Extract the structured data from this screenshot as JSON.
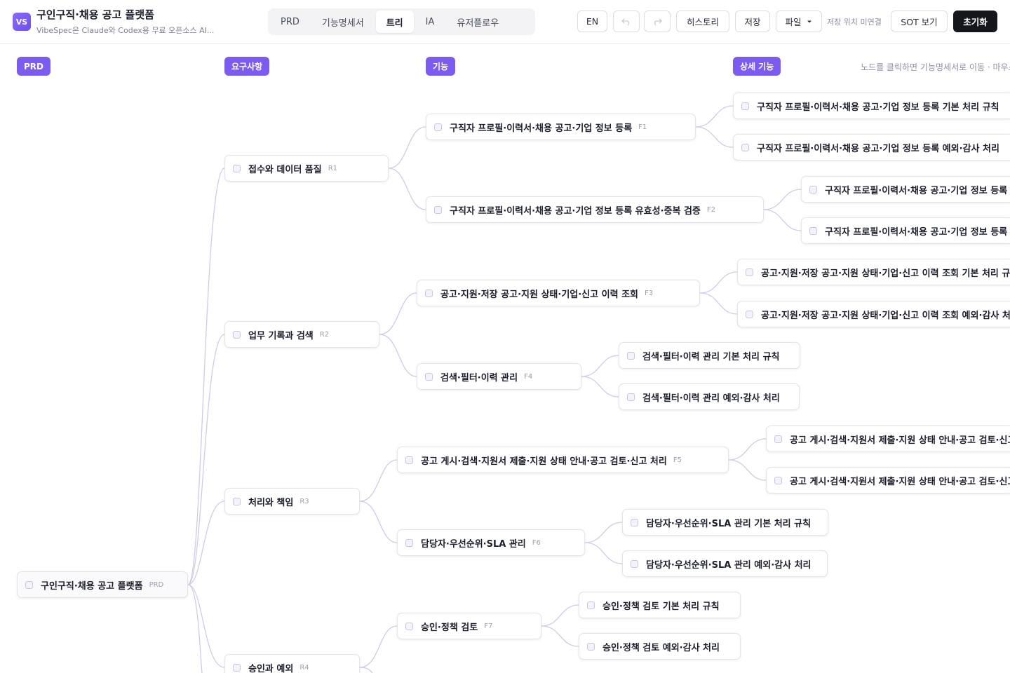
{
  "app": {
    "logo": "VS",
    "title": "구인구직·채용 공고 플랫폼",
    "subtitle": "VibeSpec은 Claude와 Codex용 무료 오픈소스 AI..."
  },
  "tabs": [
    {
      "label": "PRD",
      "active": false
    },
    {
      "label": "기능명세서",
      "active": false
    },
    {
      "label": "트리",
      "active": true
    },
    {
      "label": "IA",
      "active": false
    },
    {
      "label": "유저플로우",
      "active": false
    }
  ],
  "toolbar": {
    "lang": "EN",
    "undo_icon": "undo-icon",
    "redo_icon": "redo-icon",
    "history": "히스토리",
    "save": "저장",
    "file": "파일",
    "save_location": "저장 위치 미연결",
    "sot": "SOT 보기",
    "reset": "초기화"
  },
  "columns": {
    "prd": "PRD",
    "requirements": "요구사항",
    "features": "기능",
    "details": "상세 기능"
  },
  "hint": "노드를 클릭하면 기능명세서로 이동 · 마우스",
  "tree": {
    "root": {
      "label": "구인구직·채용 공고 플랫폼",
      "id": "PRD"
    },
    "requirements": [
      {
        "label": "접수와 데이터 품질",
        "id": "R1"
      },
      {
        "label": "업무 기록과 검색",
        "id": "R2"
      },
      {
        "label": "처리와 책임",
        "id": "R3"
      },
      {
        "label": "승인과 예외",
        "id": "R4"
      }
    ],
    "features": [
      {
        "label": "구직자 프로필·이력서·채용 공고·기업 정보 등록",
        "id": "F1"
      },
      {
        "label": "구직자 프로필·이력서·채용 공고·기업 정보 등록 유효성·중복 검증",
        "id": "F2"
      },
      {
        "label": "공고·지원·저장 공고·지원 상태·기업·신고 이력 조회",
        "id": "F3"
      },
      {
        "label": "검색·필터·이력 관리",
        "id": "F4"
      },
      {
        "label": "공고 게시·검색·지원서 제출·지원 상태 안내·공고 검토·신고 처리",
        "id": "F5"
      },
      {
        "label": "담당자·우선순위·SLA 관리",
        "id": "F6"
      },
      {
        "label": "승인·정책 검토",
        "id": "F7"
      }
    ],
    "details": [
      "구직자 프로필·이력서·채용 공고·기업 정보 등록 기본 처리 규칙",
      "구직자 프로필·이력서·채용 공고·기업 정보 등록 예외·감사 처리",
      "구직자 프로필·이력서·채용 공고·기업 정보 등록 유효성·중복 검증 기본 처리 규칙",
      "구직자 프로필·이력서·채용 공고·기업 정보 등록 유효성·중복 검증 예외·감사 처리",
      "공고·지원·저장 공고·지원 상태·기업·신고 이력 조회 기본 처리 규칙",
      "공고·지원·저장 공고·지원 상태·기업·신고 이력 조회 예외·감사 처리",
      "검색·필터·이력 관리 기본 처리 규칙",
      "검색·필터·이력 관리 예외·감사 처리",
      "공고 게시·검색·지원서 제출·지원 상태 안내·공고 검토·신고 처리 기본 처리 규칙",
      "공고 게시·검색·지원서 제출·지원 상태 안내·공고 검토·신고 처리 예외·감사 처리",
      "담당자·우선순위·SLA 관리 기본 처리 규칙",
      "담당자·우선순위·SLA 관리 예외·감사 처리",
      "승인·정책 검토 기본 처리 규칙",
      "승인·정책 검토 예외·감사 처리"
    ]
  }
}
